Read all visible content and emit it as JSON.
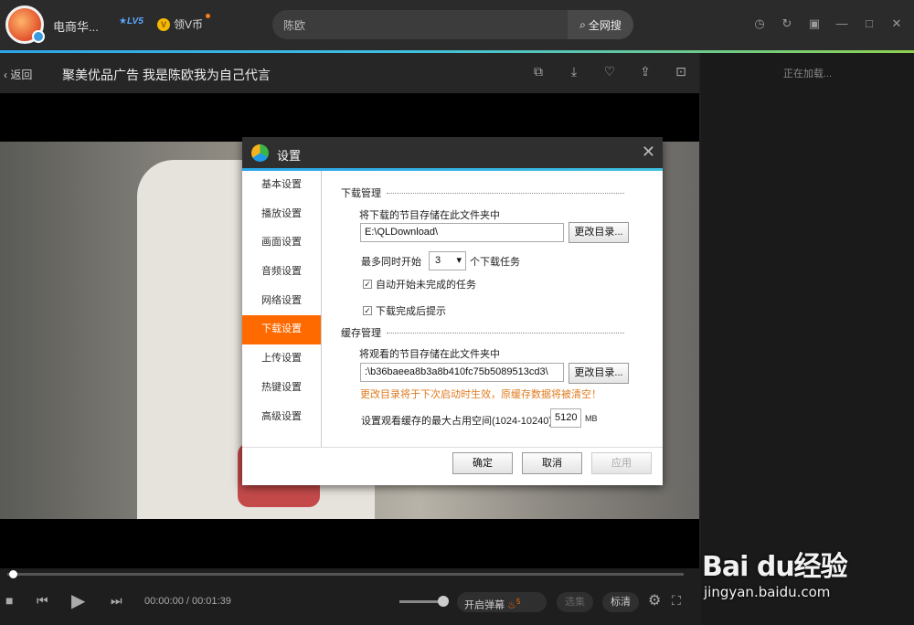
{
  "header": {
    "username": "电商华...",
    "level_badge": "LV5",
    "vcoin_label": "领V币",
    "search_value": "陈欧",
    "search_button": "全网搜"
  },
  "video": {
    "back_label": "返回",
    "title": "聚美优品广告 我是陈欧我为自己代言",
    "time_current": "00:00:00",
    "time_separator": "/",
    "time_total": "00:01:39",
    "danmaku_button": "开启弹幕",
    "danmaku_count": "5",
    "episodes_button": "选集",
    "quality_button": "标清"
  },
  "sidebar": {
    "loading_text": "正在加载..."
  },
  "watermark": {
    "brand": "Bai du经验",
    "url": "jingyan.baidu.com"
  },
  "dialog": {
    "title": "设置",
    "nav": [
      "基本设置",
      "播放设置",
      "画面设置",
      "音频设置",
      "网络设置",
      "下载设置",
      "上传设置",
      "热键设置",
      "高级设置"
    ],
    "active_index": 5,
    "download": {
      "section_title": "下载管理",
      "folder_label": "将下载的节目存储在此文件夹中",
      "folder_path": "E:\\QLDownload\\",
      "change_dir": "更改目录...",
      "max_prefix": "最多同时开始",
      "max_value": "3",
      "max_suffix": "个下载任务",
      "auto_start": "自动开始未完成的任务",
      "notify_done": "下载完成后提示"
    },
    "cache": {
      "section_title": "缓存管理",
      "folder_label": "将观看的节目存储在此文件夹中",
      "folder_path": ":\\b36baeea8b3a8b410fc75b5089513cd3\\",
      "change_dir": "更改目录...",
      "warning": "更改目录将于下次启动时生效，原缓存数据将被清空！",
      "max_space_label": "设置观看缓存的最大占用空间(1024-10240)",
      "max_space_value": "5120",
      "unit": "MB"
    },
    "buttons": {
      "ok": "确定",
      "cancel": "取消",
      "apply": "应用"
    }
  }
}
